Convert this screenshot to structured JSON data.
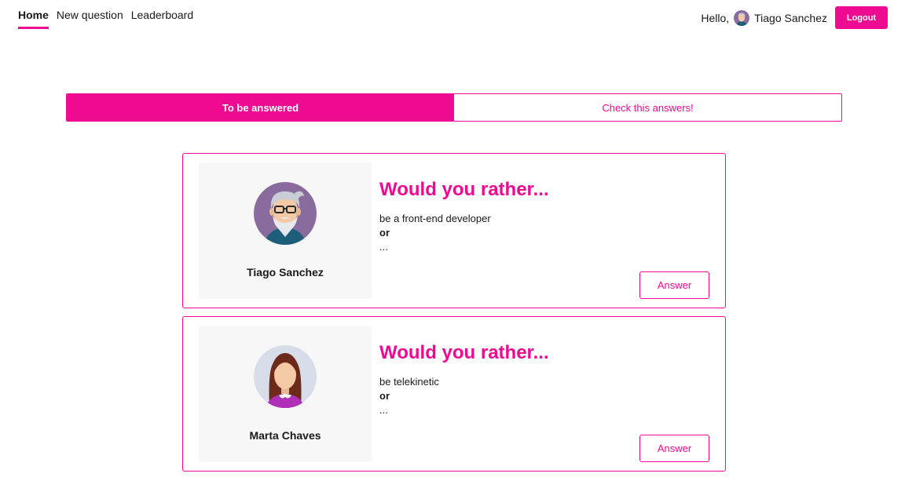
{
  "nav": {
    "items": [
      {
        "label": "Home",
        "active": true
      },
      {
        "label": "New question",
        "active": false
      },
      {
        "label": "Leaderboard",
        "active": false
      }
    ]
  },
  "user": {
    "greeting": "Hello,",
    "name": "Tiago Sanchez",
    "avatar_icon": "old-man-avatar-icon",
    "logout_label": "Logout"
  },
  "tabs": [
    {
      "label": "To be answered",
      "active": true
    },
    {
      "label": "Check this answers!",
      "active": false
    }
  ],
  "questions": [
    {
      "author": "Tiago Sanchez",
      "avatar_icon": "old-man-avatar-icon",
      "title": "Would you rather...",
      "option_one": "be a front-end developer",
      "or_label": "or",
      "ellipsis": "...",
      "answer_label": "Answer"
    },
    {
      "author": "Marta Chaves",
      "avatar_icon": "woman-avatar-icon",
      "title": "Would you rather...",
      "option_one": "be telekinetic",
      "or_label": "or",
      "ellipsis": "...",
      "answer_label": "Answer"
    }
  ],
  "colors": {
    "accent": "#ee0a91",
    "card_left_bg": "#f7f7f7"
  }
}
